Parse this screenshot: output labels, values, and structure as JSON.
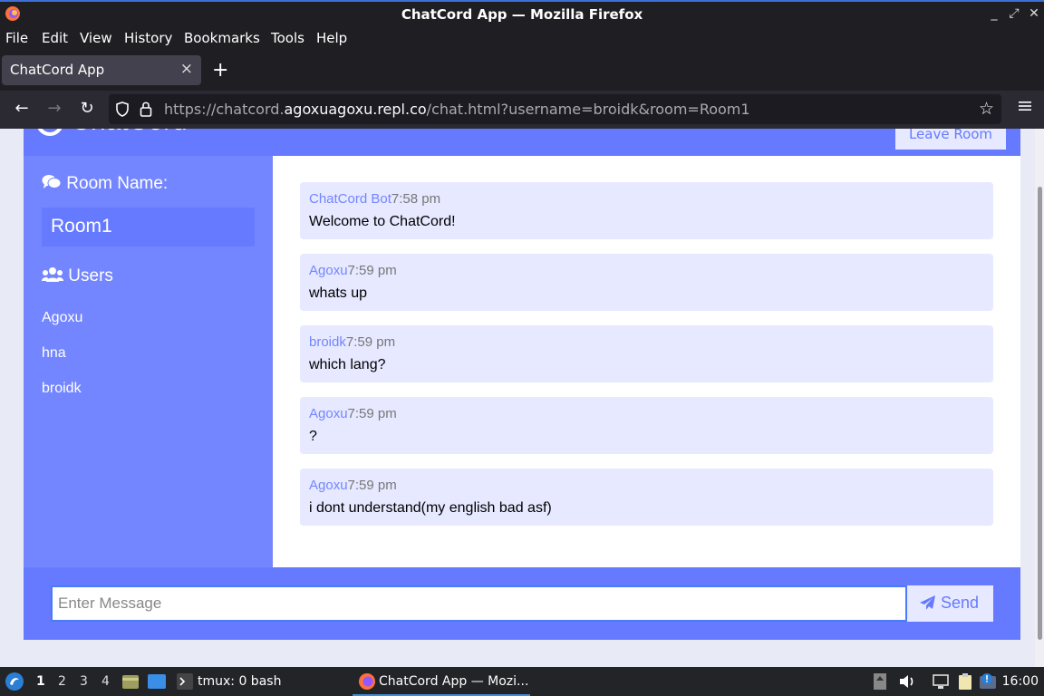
{
  "window": {
    "title": "ChatCord App — Mozilla Firefox",
    "controls": [
      "_",
      "⤢",
      "✕"
    ]
  },
  "menubar": [
    "File",
    "Edit",
    "View",
    "History",
    "Bookmarks",
    "Tools",
    "Help"
  ],
  "tab": {
    "title": "ChatCord App",
    "close": "×",
    "new_tab": "+"
  },
  "urlbar": {
    "prefix": "https://chatcord.",
    "domain": "agoxuagoxu.repl.co",
    "path": "/chat.html?username=broidk&room=Room1"
  },
  "app": {
    "brand": "ChatCord",
    "leave_button": "Leave Room",
    "room_heading": "Room Name:",
    "room_name": "Room1",
    "users_heading": "Users",
    "users": [
      "Agoxu",
      "hna",
      "broidk"
    ],
    "messages": [
      {
        "user": "ChatCord Bot",
        "time": "7:58 pm",
        "text": "Welcome to ChatCord!"
      },
      {
        "user": "Agoxu",
        "time": "7:59 pm",
        "text": "whats up"
      },
      {
        "user": "broidk",
        "time": "7:59 pm",
        "text": "which lang?"
      },
      {
        "user": "Agoxu",
        "time": "7:59 pm",
        "text": "?"
      },
      {
        "user": "Agoxu",
        "time": "7:59 pm",
        "text": "i dont understand(my english bad asf)"
      }
    ],
    "input_placeholder": "Enter Message",
    "send_label": "Send",
    "colors": {
      "primary": "#667aff",
      "sidebar": "#7386ff",
      "bubble": "#e6e9ff"
    }
  },
  "taskbar": {
    "workspaces": [
      "1",
      "2",
      "3",
      "4"
    ],
    "terminal_task": "tmux: 0 bash",
    "browser_task": "ChatCord App — Mozi...",
    "clock": "16:00"
  }
}
